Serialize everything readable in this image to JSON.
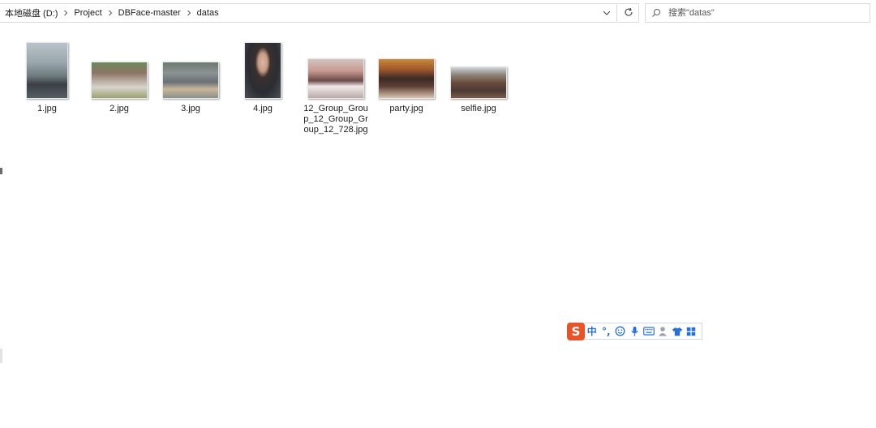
{
  "address_bar": {
    "crumbs": [
      {
        "label": "本地磁盘 (D:)"
      },
      {
        "label": "Project"
      },
      {
        "label": "DBFace-master"
      },
      {
        "label": "datas"
      }
    ]
  },
  "search": {
    "placeholder": "搜索\"datas\""
  },
  "icons": {
    "chevron": "chevron-right-icon",
    "dropdown": "chevron-down-icon",
    "refresh": "refresh-icon",
    "search": "search-icon"
  },
  "files": [
    {
      "name": "1.jpg"
    },
    {
      "name": "2.jpg"
    },
    {
      "name": "3.jpg"
    },
    {
      "name": "4.jpg"
    },
    {
      "name": "12_Group_Group_12_Group_Group_12_728.jpg"
    },
    {
      "name": "party.jpg"
    },
    {
      "name": "selfie.jpg"
    }
  ],
  "ime_toolbar": {
    "logo": "S",
    "mode": "中",
    "punct": "°,",
    "items": [
      "emoji-icon",
      "microphone-icon",
      "keyboard-icon",
      "user-icon",
      "skin-icon",
      "toolbox-icon"
    ],
    "colors": {
      "logo": "#e8542a",
      "buttons": "#2a6fd6"
    }
  }
}
